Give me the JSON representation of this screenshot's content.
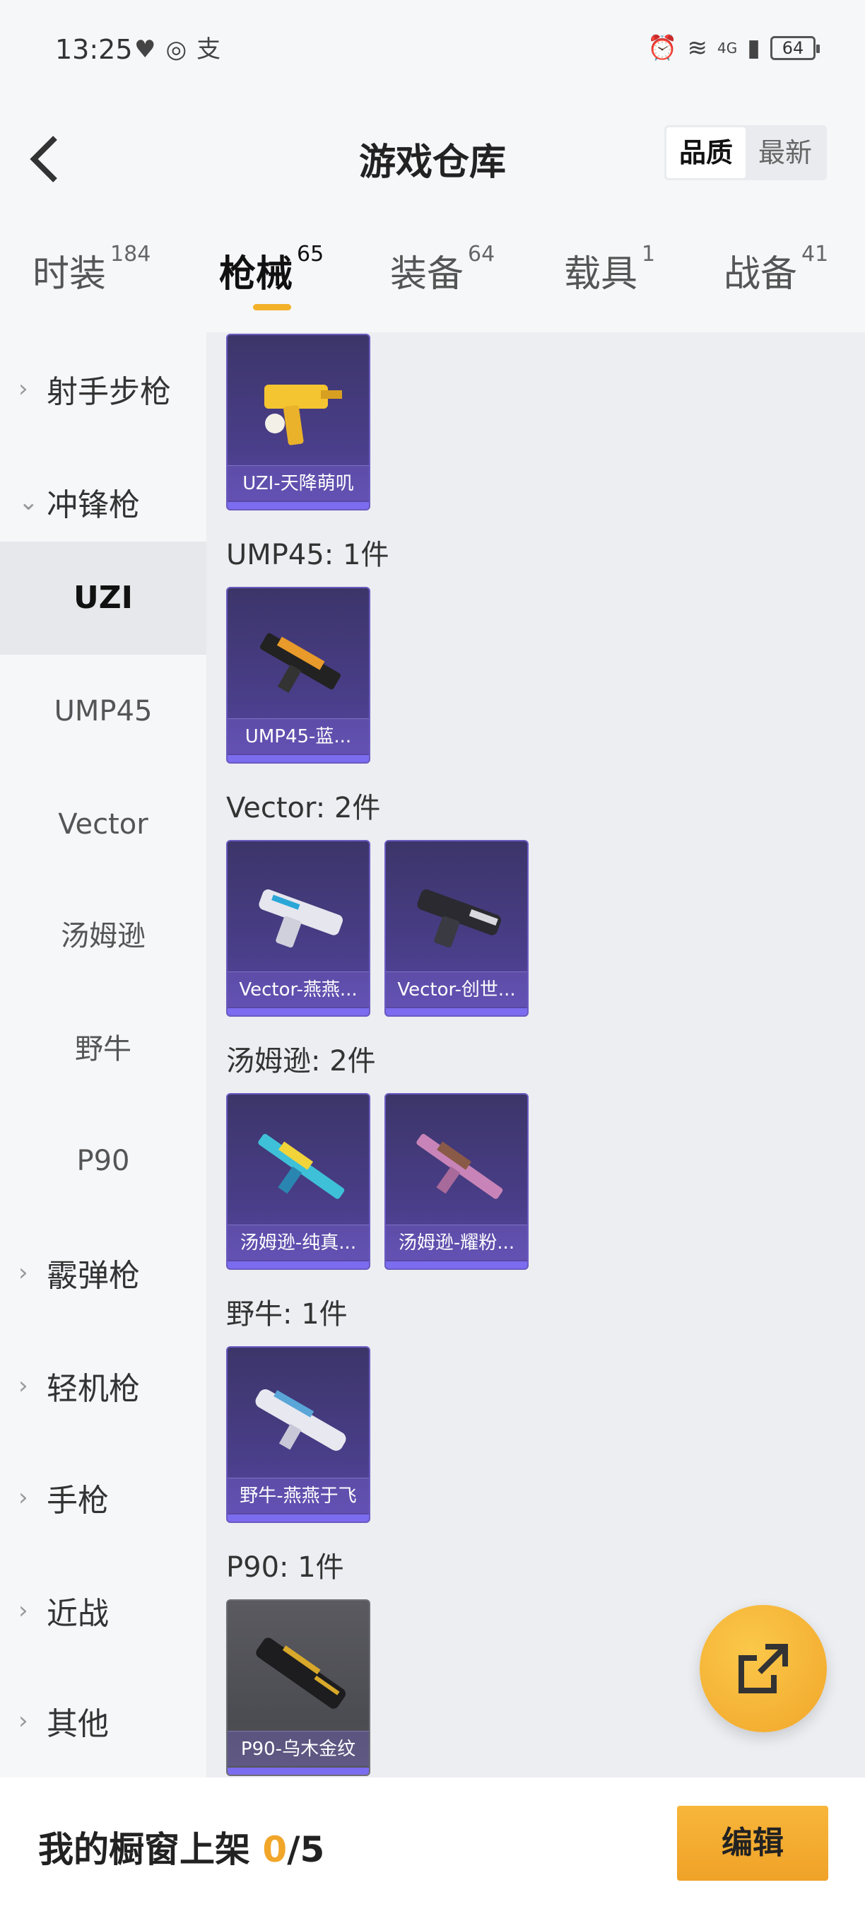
{
  "status": {
    "time": "13:25",
    "battery": "64",
    "network": "4G"
  },
  "header": {
    "title": "游戏仓库",
    "sort": {
      "quality": "品质",
      "newest": "最新"
    }
  },
  "tabs": [
    {
      "label": "时装",
      "count": "184"
    },
    {
      "label": "枪械",
      "count": "65"
    },
    {
      "label": "装备",
      "count": "64"
    },
    {
      "label": "载具",
      "count": "1"
    },
    {
      "label": "战备",
      "count": "41"
    }
  ],
  "sidebar": {
    "rifle": "射手步枪",
    "smg": "冲锋枪",
    "smg_items": [
      "UZI",
      "UMP45",
      "Vector",
      "汤姆逊",
      "野牛",
      "P90"
    ],
    "shotgun": "霰弹枪",
    "lmg": "轻机枪",
    "pistol": "手枪",
    "melee": "近战",
    "other": "其他"
  },
  "sections": {
    "uzi_items": [
      "UZI-天降萌叽"
    ],
    "ump45_title": "UMP45: 1件",
    "ump45_items": [
      "UMP45-蓝..."
    ],
    "vector_title": "Vector: 2件",
    "vector_items": [
      "Vector-燕燕...",
      "Vector-创世..."
    ],
    "thompson_title": "汤姆逊: 2件",
    "thompson_items": [
      "汤姆逊-纯真...",
      "汤姆逊-耀粉..."
    ],
    "bizon_title": "野牛: 1件",
    "bizon_items": [
      "野牛-燕燕于飞"
    ],
    "p90_title": "P90: 1件",
    "p90_items": [
      "P90-乌木金纹"
    ]
  },
  "bottom": {
    "showcase_label": "我的橱窗上架",
    "showcase_count": "0",
    "showcase_total": "/5",
    "edit": "编辑"
  },
  "colors": {
    "accent": "#f3b12a",
    "card_purple": "#4a3e8a"
  }
}
